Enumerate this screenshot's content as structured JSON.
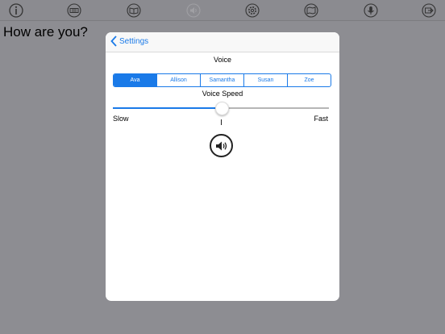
{
  "toolbar": {
    "buttons": [
      {
        "name": "info-icon"
      },
      {
        "name": "keyboard-icon"
      },
      {
        "name": "book-icon"
      },
      {
        "name": "speaker-disabled-icon"
      },
      {
        "name": "gear-icon"
      },
      {
        "name": "map-icon"
      },
      {
        "name": "microphone-icon"
      },
      {
        "name": "export-icon"
      }
    ]
  },
  "main": {
    "text": "How are you?"
  },
  "settings": {
    "back_label": "Settings",
    "voice_title": "Voice",
    "voices": [
      "Ava",
      "Allison",
      "Samantha",
      "Susan",
      "Zoe"
    ],
    "selected_voice": "Ava",
    "speed_title": "Voice Speed",
    "speed_value": 0.5,
    "slow_label": "Slow",
    "fast_label": "Fast",
    "speak_icon": "speaker-icon"
  },
  "colors": {
    "accent": "#1a7ae8",
    "dim_background": "#8d8d92"
  }
}
